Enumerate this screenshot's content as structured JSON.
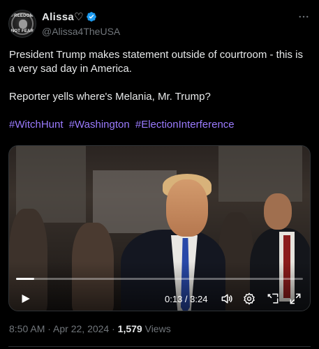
{
  "author": {
    "display_name": "Alissa♡",
    "handle": "@Alissa4TheUSA",
    "verified": true,
    "avatar_text_top": "FREEDOM",
    "avatar_text_bottom": "NOT FEAR"
  },
  "tweet": {
    "line1": "President Trump makes statement outside of courtroom - this is a very sad day in America.",
    "line2": "Reporter yells where's Melania, Mr. Trump?",
    "hashtags": [
      "#WitchHunt",
      "#Washington",
      "#ElectionInterference"
    ]
  },
  "video": {
    "current_time": "0:13",
    "separator": " / ",
    "duration": "3:24",
    "progress_fraction": 0.064
  },
  "meta": {
    "time": "8:50 AM",
    "sep1": " · ",
    "date": "Apr 22, 2024",
    "sep2": " · ",
    "views_count": "1,579",
    "views_label": " Views"
  },
  "colors": {
    "background": "#000000",
    "text": "#e7e9ea",
    "secondary": "#71767b",
    "hashtag": "#9b7bff",
    "verified": "#1d9bf0"
  },
  "icons": {
    "more": "more-horizontal-icon",
    "verified": "verified-badge-icon",
    "play": "play-icon",
    "volume": "volume-icon",
    "settings": "settings-gear-icon",
    "pip": "picture-in-picture-icon",
    "fullscreen": "fullscreen-icon"
  }
}
